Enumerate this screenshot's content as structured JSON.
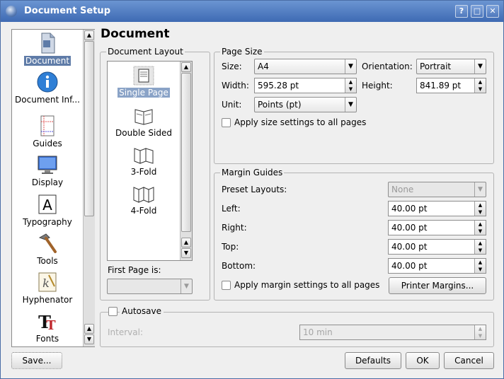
{
  "window": {
    "title": "Document Setup",
    "buttons": [
      "?",
      "□",
      "✕"
    ]
  },
  "sidebar": {
    "items": [
      {
        "label": "Document",
        "icon": "document-icon",
        "selected": true
      },
      {
        "label": "Document Inf...",
        "icon": "info-icon",
        "selected": false
      },
      {
        "label": "Guides",
        "icon": "guides-icon",
        "selected": false
      },
      {
        "label": "Display",
        "icon": "display-icon",
        "selected": false
      },
      {
        "label": "Typography",
        "icon": "typography-icon",
        "selected": false
      },
      {
        "label": "Tools",
        "icon": "hammer-icon",
        "selected": false
      },
      {
        "label": "Hyphenator",
        "icon": "hyphenator-icon",
        "selected": false
      },
      {
        "label": "Fonts",
        "icon": "fonts-icon",
        "selected": false
      }
    ]
  },
  "main": {
    "heading": "Document",
    "document_layout": {
      "title": "Document Layout",
      "items": [
        {
          "label": "Single Page",
          "icon": "single-page-icon",
          "selected": true
        },
        {
          "label": "Double Sided",
          "icon": "double-sided-icon",
          "selected": false
        },
        {
          "label": "3-Fold",
          "icon": "three-fold-icon",
          "selected": false
        },
        {
          "label": "4-Fold",
          "icon": "four-fold-icon",
          "selected": false
        }
      ],
      "first_page_label": "First Page is:",
      "first_page_value": ""
    },
    "page_size": {
      "title": "Page Size",
      "size_label": "Size:",
      "size_value": "A4",
      "orientation_label": "Orientation:",
      "orientation_value": "Portrait",
      "width_label": "Width:",
      "width_value": "595.28 pt",
      "height_label": "Height:",
      "height_value": "841.89 pt",
      "unit_label": "Unit:",
      "unit_value": "Points (pt)",
      "apply_all_label": "Apply size settings to all pages"
    },
    "margin_guides": {
      "title": "Margin Guides",
      "preset_label": "Preset Layouts:",
      "preset_value": "None",
      "left_label": "Left:",
      "left_value": "40.00 pt",
      "right_label": "Right:",
      "right_value": "40.00 pt",
      "top_label": "Top:",
      "top_value": "40.00 pt",
      "bottom_label": "Bottom:",
      "bottom_value": "40.00 pt",
      "apply_all_label": "Apply margin settings to all pages",
      "printer_margins_label": "Printer Margins..."
    },
    "autosave": {
      "label": "Autosave",
      "interval_label": "Interval:",
      "interval_value": "10 min"
    }
  },
  "footer": {
    "save_label": "Save...",
    "defaults_label": "Defaults",
    "ok_label": "OK",
    "cancel_label": "Cancel"
  }
}
